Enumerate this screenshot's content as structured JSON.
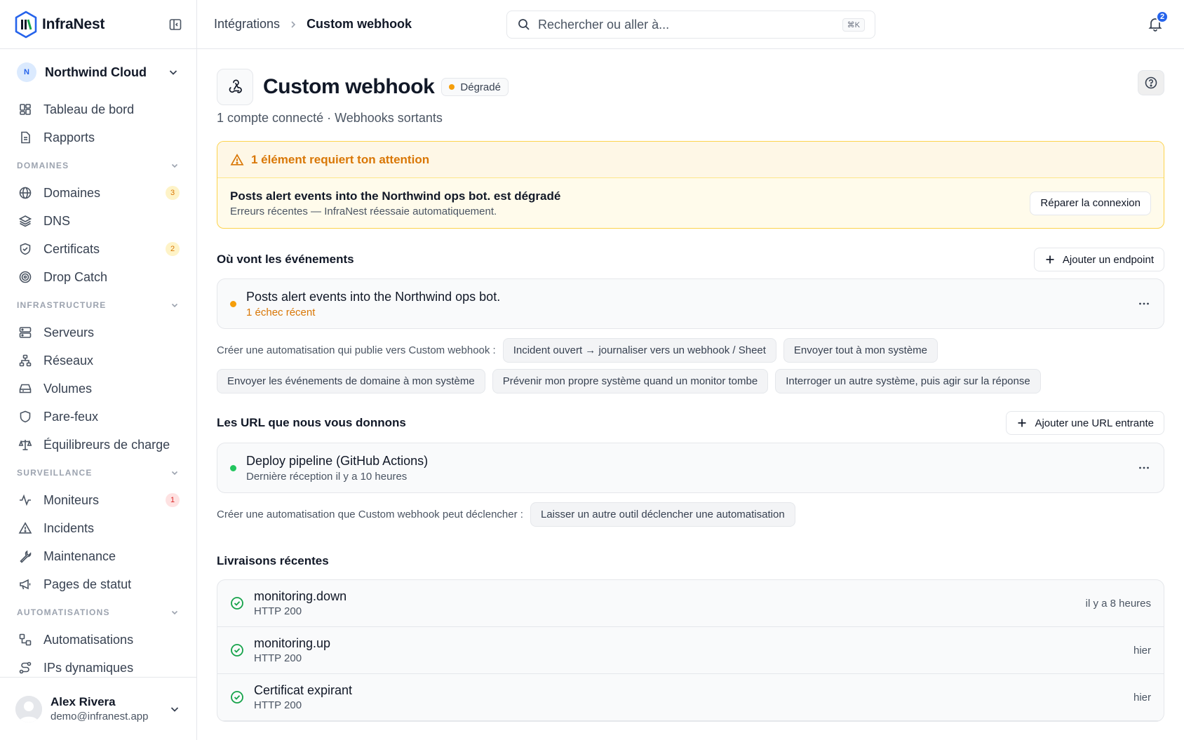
{
  "brand": {
    "name": "InfraNest"
  },
  "org": {
    "initial": "N",
    "name": "Northwind Cloud"
  },
  "nav": {
    "top": [
      {
        "label": "Tableau de bord",
        "icon": "dashboard-icon"
      },
      {
        "label": "Rapports",
        "icon": "report-icon"
      }
    ],
    "sections": [
      {
        "title": "DOMAINES",
        "items": [
          {
            "label": "Domaines",
            "icon": "globe-icon",
            "badge": "3",
            "badge_color": "amber"
          },
          {
            "label": "DNS",
            "icon": "layers-icon"
          },
          {
            "label": "Certificats",
            "icon": "shield-check-icon",
            "badge": "2",
            "badge_color": "amber"
          },
          {
            "label": "Drop Catch",
            "icon": "target-icon"
          }
        ]
      },
      {
        "title": "INFRASTRUCTURE",
        "items": [
          {
            "label": "Serveurs",
            "icon": "server-icon"
          },
          {
            "label": "Réseaux",
            "icon": "network-icon"
          },
          {
            "label": "Volumes",
            "icon": "drive-icon"
          },
          {
            "label": "Pare-feux",
            "icon": "shield-icon"
          },
          {
            "label": "Équilibreurs de charge",
            "icon": "scale-icon"
          }
        ]
      },
      {
        "title": "SURVEILLANCE",
        "items": [
          {
            "label": "Moniteurs",
            "icon": "activity-icon",
            "badge": "1",
            "badge_color": "red"
          },
          {
            "label": "Incidents",
            "icon": "warning-icon"
          },
          {
            "label": "Maintenance",
            "icon": "wrench-icon"
          },
          {
            "label": "Pages de statut",
            "icon": "megaphone-icon"
          }
        ]
      },
      {
        "title": "AUTOMATISATIONS",
        "items": [
          {
            "label": "Automatisations",
            "icon": "workflow-icon"
          },
          {
            "label": "IPs dynamiques",
            "icon": "route-icon"
          }
        ]
      }
    ]
  },
  "user": {
    "name": "Alex Rivera",
    "email": "demo@infranest.app"
  },
  "topbar": {
    "breadcrumb_parent": "Intégrations",
    "breadcrumb_current": "Custom webhook",
    "search_placeholder": "Rechercher ou aller à...",
    "search_shortcut": "⌘K",
    "notification_count": "2"
  },
  "page": {
    "title": "Custom webhook",
    "status": "Dégradé",
    "subtitle": "1 compte connecté · Webhooks sortants"
  },
  "alert": {
    "heading": "1 élément requiert ton attention",
    "title": "Posts alert events into the Northwind ops bot. est dégradé",
    "detail": "Erreurs récentes — InfraNest réessaie automatiquement.",
    "action": "Réparer la connexion"
  },
  "outgoing": {
    "title": "Où vont les événements",
    "add_label": "Ajouter un endpoint",
    "endpoint": {
      "name": "Posts alert events into the Northwind ops bot.",
      "status": "1 échec récent"
    },
    "chips_label": "Créer une automatisation qui publie vers Custom webhook :",
    "chips": [
      "Incident ouvert → journaliser vers un webhook / Sheet",
      "Envoyer tout à mon système",
      "Envoyer les événements de domaine à mon système",
      "Prévenir mon propre système quand un monitor tombe",
      "Interroger un autre système, puis agir sur la réponse"
    ]
  },
  "incoming": {
    "title": "Les URL que nous vous donnons",
    "add_label": "Ajouter une URL entrante",
    "url": {
      "name": "Deploy pipeline (GitHub Actions)",
      "status": "Dernière réception il y a 10 heures"
    },
    "chips_label": "Créer une automatisation que Custom webhook peut déclencher :",
    "chips": [
      "Laisser un autre outil déclencher une automatisation"
    ]
  },
  "deliveries": {
    "title": "Livraisons récentes",
    "rows": [
      {
        "event": "monitoring.down",
        "code": "HTTP 200",
        "time": "il y a 8 heures"
      },
      {
        "event": "monitoring.up",
        "code": "HTTP 200",
        "time": "hier"
      },
      {
        "event": "Certificat expirant",
        "code": "HTTP 200",
        "time": "hier"
      }
    ]
  },
  "colors": {
    "accent": "#2563eb",
    "warning": "#f59e0b",
    "success": "#22c55e"
  }
}
